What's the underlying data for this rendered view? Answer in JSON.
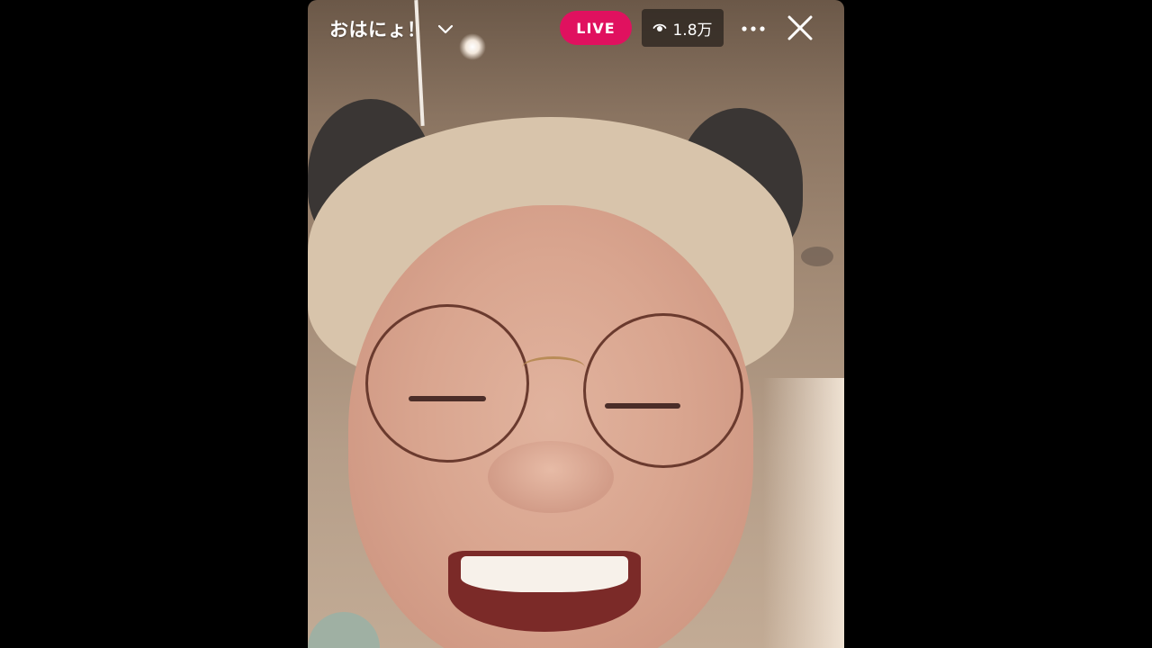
{
  "stream": {
    "title": "おはにょ！",
    "live_label": "LIVE",
    "viewer_count": "1.8万"
  },
  "icons": {
    "title_dropdown": "chevron-down-icon",
    "viewers": "eye-icon",
    "menu": "more-icon",
    "close": "close-icon"
  },
  "colors": {
    "live_badge": "#e0115f",
    "viewer_badge_bg": "#26201c",
    "overlay_text": "#ffffff"
  }
}
